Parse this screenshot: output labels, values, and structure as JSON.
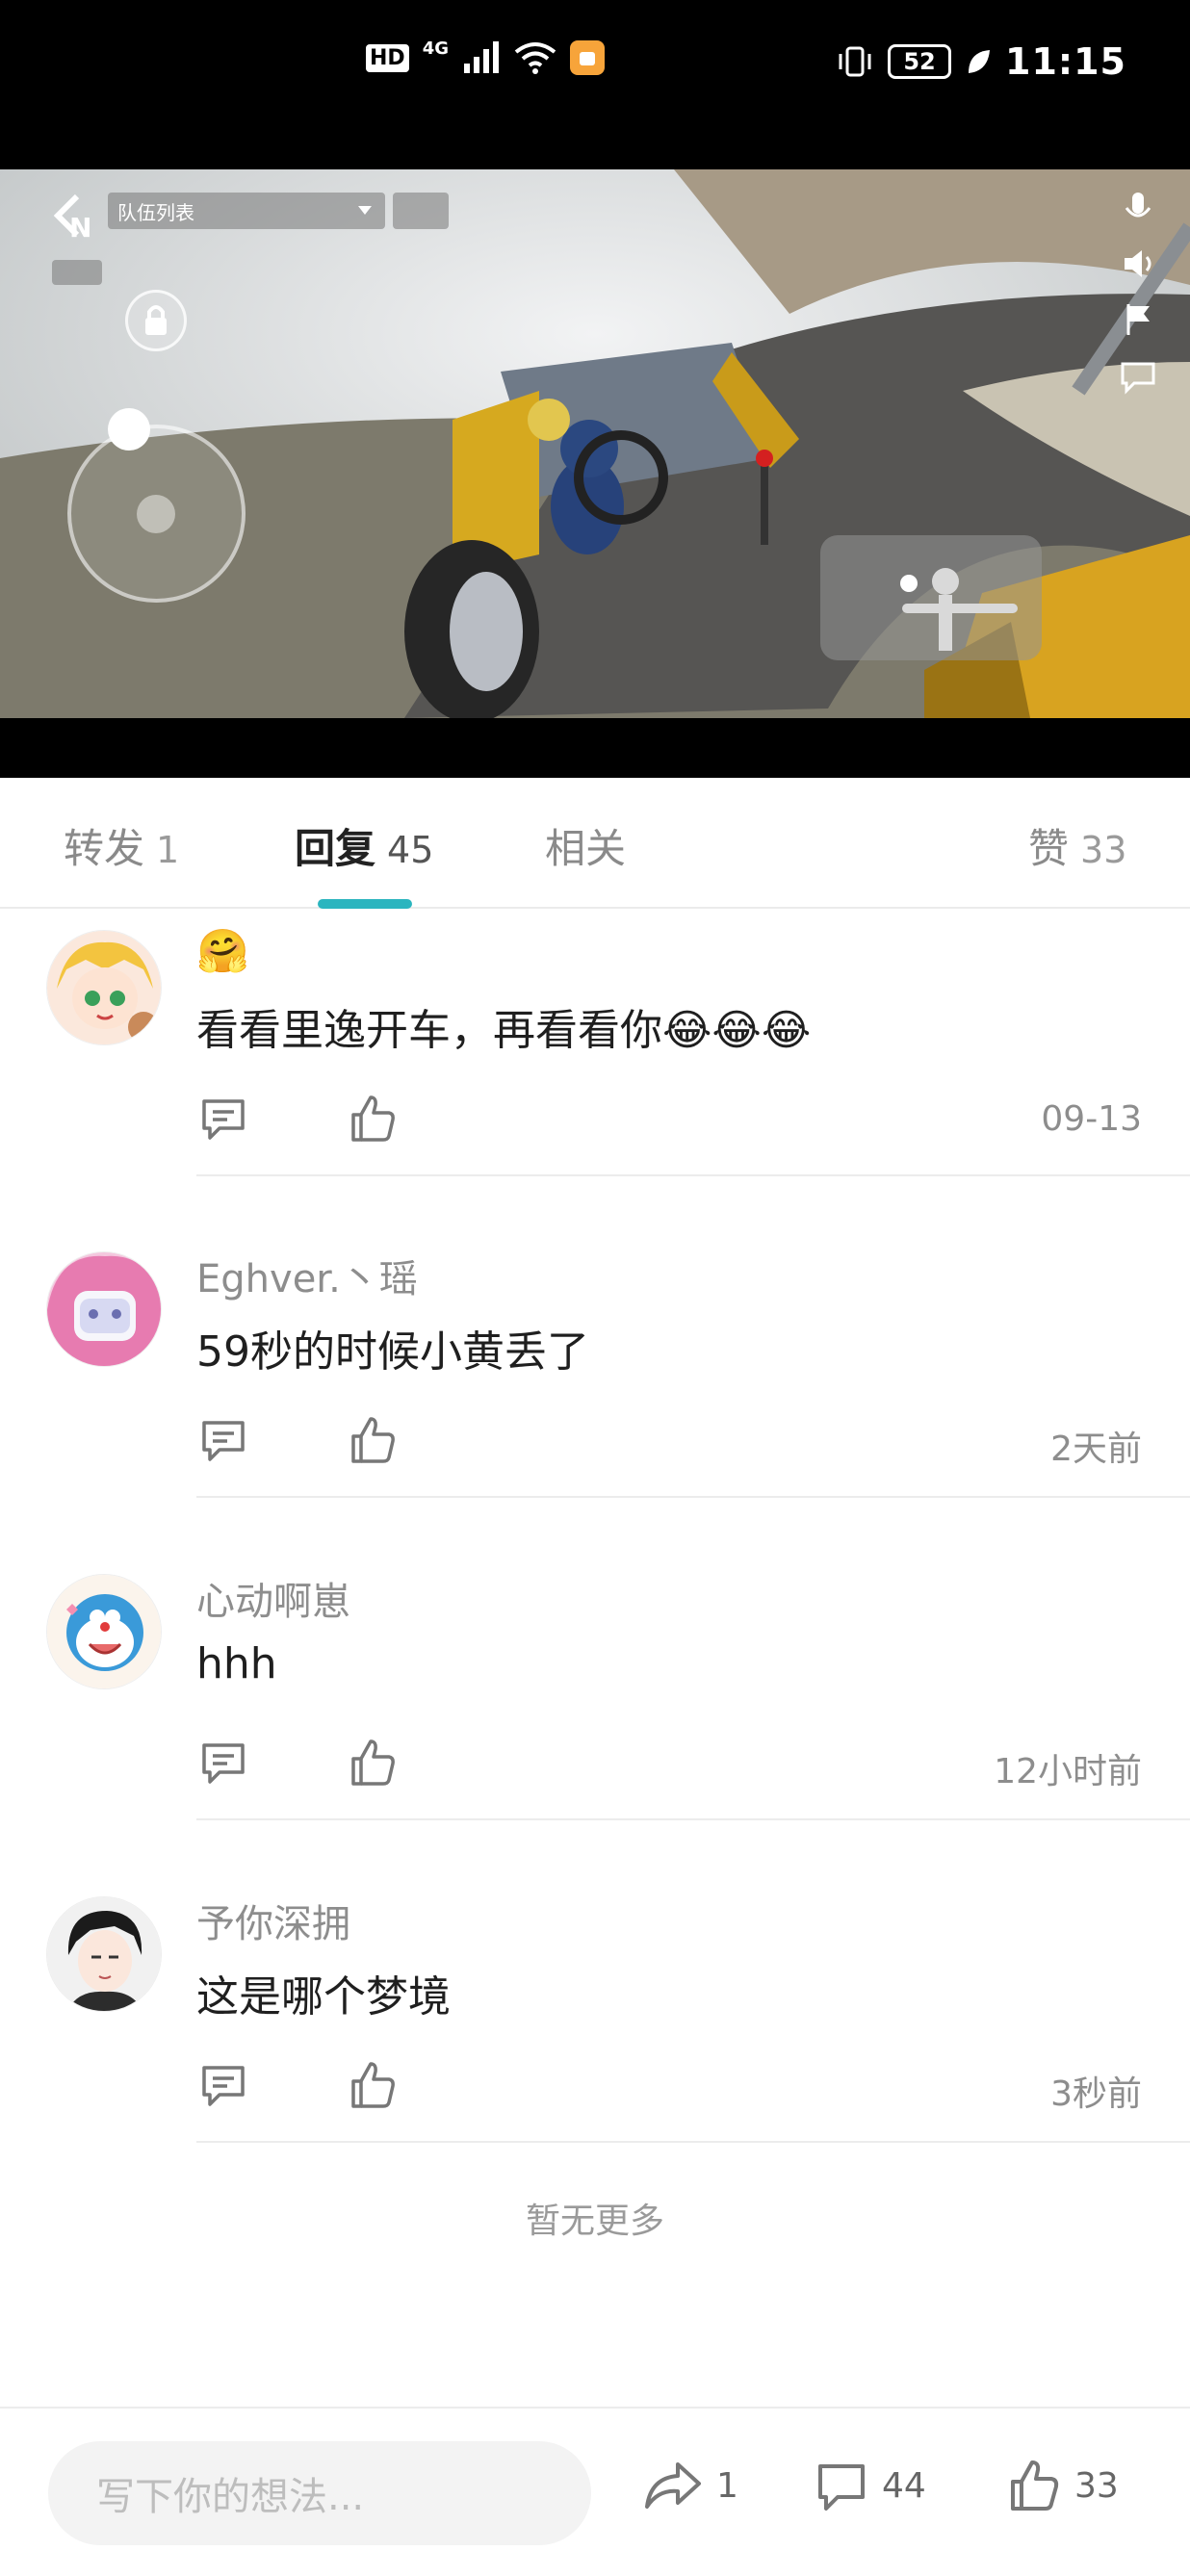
{
  "status_bar": {
    "hd": "HD",
    "network": "4G",
    "battery": "52",
    "time": "11:15"
  },
  "video": {
    "team_list_label": "队伍列表"
  },
  "tabs": [
    {
      "label": "转发",
      "count": "1"
    },
    {
      "label": "回复",
      "count": "45"
    },
    {
      "label": "相关",
      "count": ""
    },
    {
      "label": "赞",
      "count": "33"
    }
  ],
  "comments": [
    {
      "name": "",
      "text": "看看里逸开车，再看看你😂😂😂",
      "time": "09-13",
      "name_emoji": "🤗"
    },
    {
      "name": "Eghver.丶瑶",
      "text": "59秒的时候小黄丢了",
      "time": "2天前"
    },
    {
      "name": "心动啊崽",
      "text": "hhh",
      "time": "12小时前"
    },
    {
      "name": "予你深拥",
      "text": "这是哪个梦境",
      "time": "3秒前"
    }
  ],
  "no_more": "暂无更多",
  "bottom_bar": {
    "input_placeholder": "写下你的想法...",
    "share_count": "1",
    "comment_count": "44",
    "like_count": "33"
  },
  "colors": {
    "accent": "#2bb5bf",
    "text_primary": "#1f1f1f",
    "text_secondary": "#8d8d8d"
  }
}
